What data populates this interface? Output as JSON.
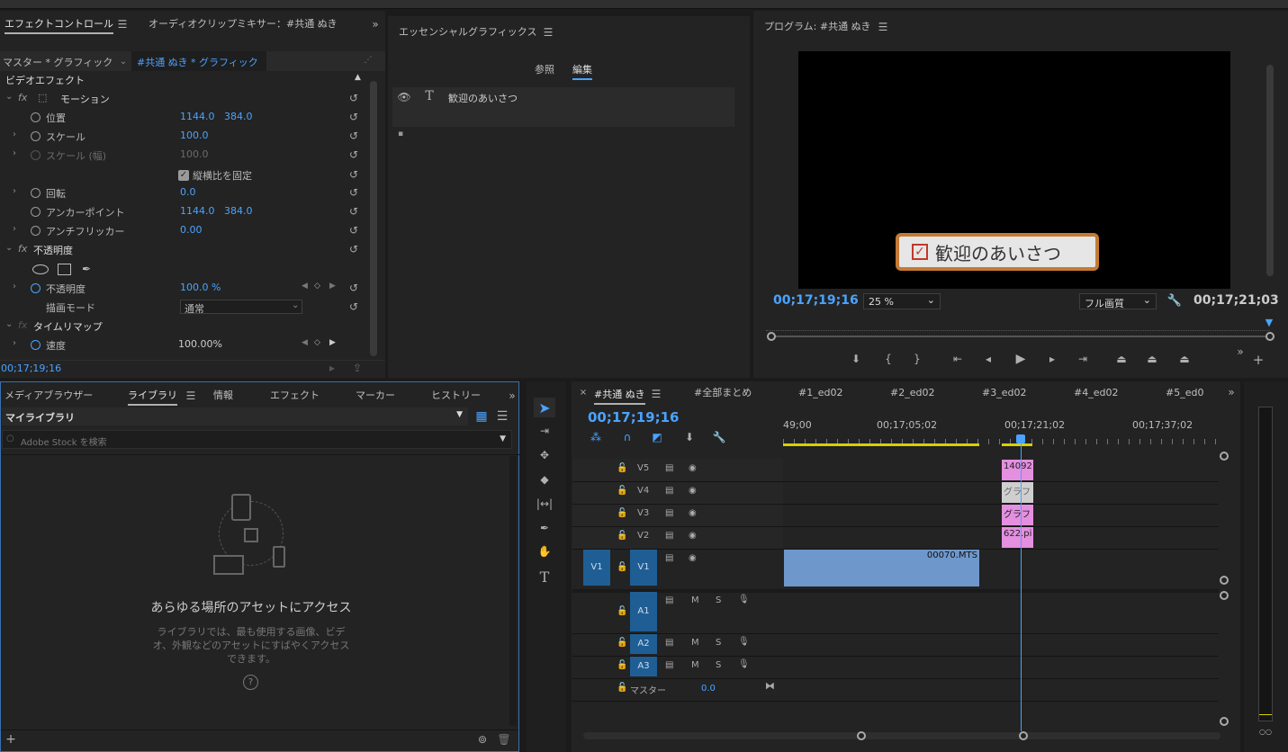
{
  "effect_controls": {
    "tabs": [
      "エフェクトコントロール",
      "オーディオクリップミキサー：#共通 ぬき"
    ],
    "master_label": "マスター * グラフィック",
    "clip_label": "#共通 ぬき * グラフィック",
    "video_effects": "ビデオエフェクト",
    "motion": "モーション",
    "position_label": "位置",
    "position_x": "1144.0",
    "position_y": "384.0",
    "scale_label": "スケール",
    "scale_value": "100.0",
    "scale_width_label": "スケール (幅)",
    "scale_width_value": "100.0",
    "uniform_scale": "縦横比を固定",
    "rotation_label": "回転",
    "rotation_value": "0.0",
    "anchor_label": "アンカーポイント",
    "anchor_x": "1144.0",
    "anchor_y": "384.0",
    "antiflicker_label": "アンチフリッカー",
    "antiflicker_value": "0.00",
    "opacity_section": "不透明度",
    "opacity_label": "不透明度",
    "opacity_value": "100.0 %",
    "blend_label": "描画モード",
    "blend_value": "通常",
    "time_remap": "タイムリマップ",
    "speed_label": "速度",
    "speed_value": "100.00%",
    "timecode": "00;17;19;16"
  },
  "essential_graphics": {
    "title": "エッセンシャルグラフィックス",
    "tab_browse": "参照",
    "tab_edit": "編集",
    "layer_name": "歓迎のあいさつ"
  },
  "program": {
    "title": "プログラム: #共通 ぬき",
    "overlay_text": "歓迎のあいさつ",
    "timecode_current": "00;17;19;16",
    "zoom": "25 %",
    "quality": "フル画質",
    "timecode_duration": "00;17;21;03"
  },
  "library": {
    "tabs": [
      "メディアブラウザー",
      "ライブラリ",
      "情報",
      "エフェクト",
      "マーカー",
      "ヒストリー"
    ],
    "library_select": "マイライブラリ",
    "search_placeholder": "Adobe Stock を検索",
    "heading": "あらゆる場所のアセットにアクセス",
    "description": "ライブラリでは、最も使用する画像、ビデオ、外観などのアセットにすばやくアクセスできます。"
  },
  "timeline": {
    "tabs": [
      "#共通 ぬき",
      "#全部まとめ",
      "#1_ed02",
      "#2_ed02",
      "#3_ed02",
      "#4_ed02",
      "#5_ed0"
    ],
    "timecode": "00;17;19;16",
    "ruler": [
      "49;00",
      "00;17;05;02",
      "00;17;21;02",
      "00;17;37;02"
    ],
    "video_tracks": [
      "V5",
      "V4",
      "V3",
      "V2",
      "V1"
    ],
    "audio_tracks": [
      "A1",
      "A2",
      "A3"
    ],
    "source_v1": "V1",
    "source_a1": "A1",
    "master_label": "マスター",
    "master_value": "0.0",
    "clips": {
      "v5": "14092",
      "v4": "グラフ",
      "v3": "グラフ",
      "v2": "622.pi",
      "v1": "00070.MTS"
    },
    "m_label": "M",
    "s_label": "S"
  },
  "colors": {
    "accent": "#4aa3ff",
    "clip_pink": "#e48fe0",
    "clip_gray": "#cfcfcf",
    "clip_blue": "#6e98cc",
    "track_target": "#1f5e94"
  }
}
